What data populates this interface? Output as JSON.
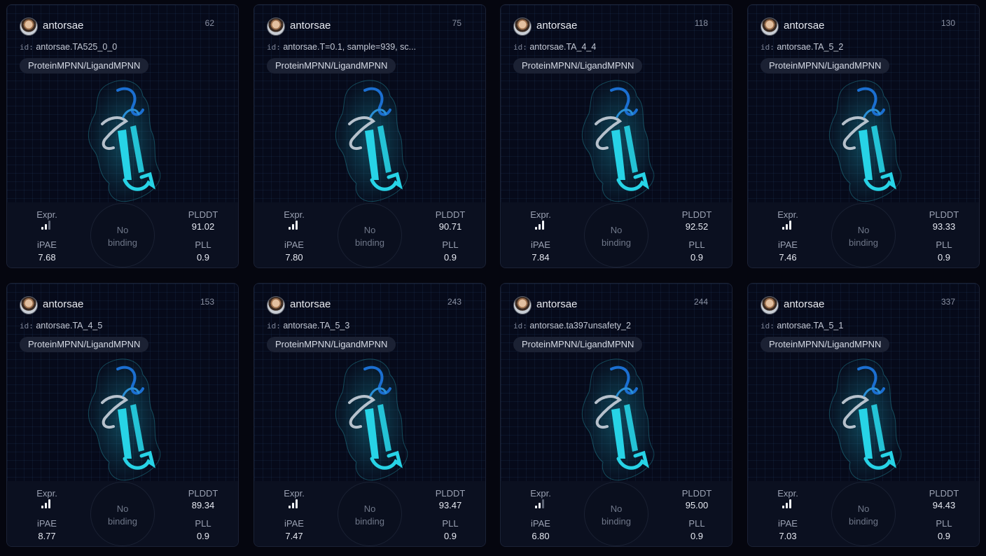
{
  "stat_labels": {
    "expr": "Expr.",
    "ipae": "iPAE",
    "plddt": "PLDDT",
    "pll": "PLL"
  },
  "binding_text": {
    "line1": "No",
    "line2": "binding"
  },
  "colors": {
    "accent_cyan": "#27d3e6",
    "accent_blue": "#1b6fd1",
    "background": "#05060f"
  },
  "cards": [
    {
      "user": "antorsae",
      "count": "62",
      "id_key": "id:",
      "id": "antorsae.TA525_0_0",
      "tag": "ProteinMPNN/LigandMPNN",
      "expr_level": 2,
      "ipae": "7.68",
      "plddt": "91.02",
      "pll": "0.9"
    },
    {
      "user": "antorsae",
      "count": "75",
      "id_key": "id:",
      "id": "antorsae.T=0.1, sample=939, sc...",
      "tag": "ProteinMPNN/LigandMPNN",
      "expr_level": 3,
      "ipae": "7.80",
      "plddt": "90.71",
      "pll": "0.9"
    },
    {
      "user": "antorsae",
      "count": "118",
      "id_key": "id:",
      "id": "antorsae.TA_4_4",
      "tag": "ProteinMPNN/LigandMPNN",
      "expr_level": 3,
      "ipae": "7.84",
      "plddt": "92.52",
      "pll": "0.9"
    },
    {
      "user": "antorsae",
      "count": "130",
      "id_key": "id:",
      "id": "antorsae.TA_5_2",
      "tag": "ProteinMPNN/LigandMPNN",
      "expr_level": 3,
      "ipae": "7.46",
      "plddt": "93.33",
      "pll": "0.9"
    },
    {
      "user": "antorsae",
      "count": "153",
      "id_key": "id:",
      "id": "antorsae.TA_4_5",
      "tag": "ProteinMPNN/LigandMPNN",
      "expr_level": 3,
      "ipae": "8.77",
      "plddt": "89.34",
      "pll": "0.9"
    },
    {
      "user": "antorsae",
      "count": "243",
      "id_key": "id:",
      "id": "antorsae.TA_5_3",
      "tag": "ProteinMPNN/LigandMPNN",
      "expr_level": 3,
      "ipae": "7.47",
      "plddt": "93.47",
      "pll": "0.9"
    },
    {
      "user": "antorsae",
      "count": "244",
      "id_key": "id:",
      "id": "antorsae.ta397unsafety_2",
      "tag": "ProteinMPNN/LigandMPNN",
      "expr_level": 2,
      "ipae": "6.80",
      "plddt": "95.00",
      "pll": "0.9"
    },
    {
      "user": "antorsae",
      "count": "337",
      "id_key": "id:",
      "id": "antorsae.TA_5_1",
      "tag": "ProteinMPNN/LigandMPNN",
      "expr_level": 3,
      "ipae": "7.03",
      "plddt": "94.43",
      "pll": "0.9"
    }
  ]
}
